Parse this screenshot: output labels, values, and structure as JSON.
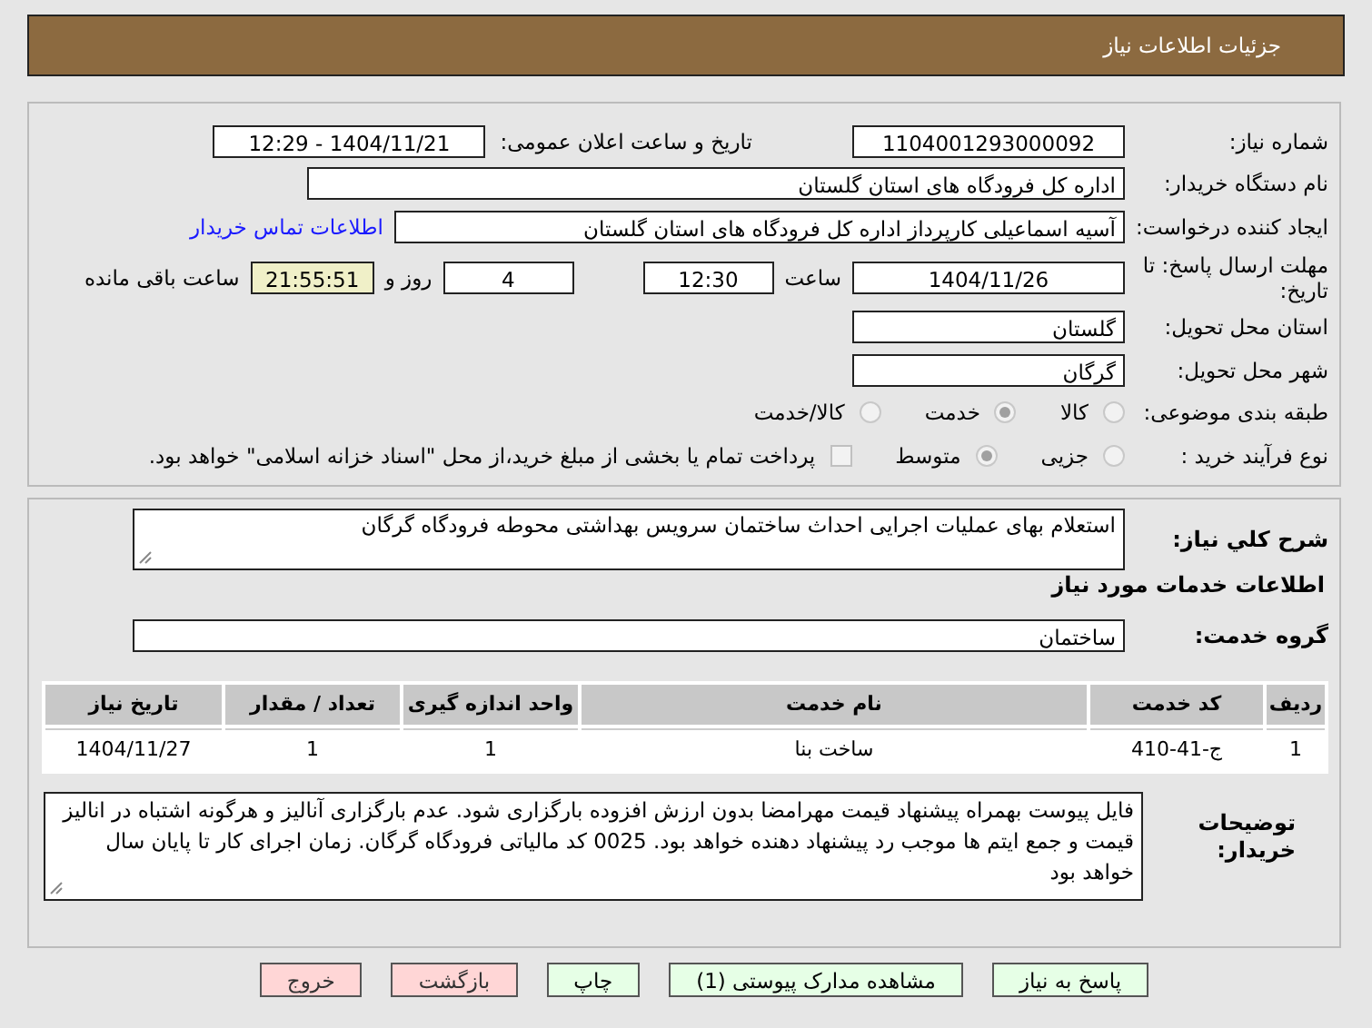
{
  "header": {
    "title": "جزئیات اطلاعات نیاز"
  },
  "need_number": {
    "label": "شماره نیاز:",
    "value": "1104001293000092"
  },
  "announce": {
    "label": "تاریخ و ساعت اعلان عمومی:",
    "value": "1404/11/21 - 12:29"
  },
  "buyer_org": {
    "label": "نام دستگاه خریدار:",
    "value": "اداره کل فرودگاه های استان گلستان"
  },
  "requester": {
    "label": "ایجاد کننده درخواست:",
    "value": "آسیه اسماعیلی کارپرداز اداره کل فرودگاه های استان گلستان",
    "link": "اطلاعات تماس خریدار"
  },
  "deadline": {
    "label": "مهلت ارسال پاسخ: تا تاریخ:",
    "date": "1404/11/26",
    "time_label": "ساعت",
    "time": "12:30",
    "days": "4",
    "days_label": "روز و",
    "remaining": "21:55:51",
    "remaining_label": "ساعت باقی مانده"
  },
  "province": {
    "label": "استان محل تحویل:",
    "value": "گلستان"
  },
  "city": {
    "label": "شهر محل تحویل:",
    "value": "گرگان"
  },
  "category": {
    "label": "طبقه بندی موضوعی:",
    "options": [
      {
        "label": "کالا",
        "selected": false
      },
      {
        "label": "خدمت",
        "selected": true
      },
      {
        "label": "کالا/خدمت",
        "selected": false
      }
    ]
  },
  "purchase_type": {
    "label": "نوع فرآیند خرید :",
    "options": [
      {
        "label": "جزیی",
        "selected": false
      },
      {
        "label": "متوسط",
        "selected": true
      }
    ],
    "payment_checkbox": {
      "checked": false,
      "label": "پرداخت تمام یا بخشی از مبلغ خرید،از محل \"اسناد خزانه اسلامی\" خواهد بود."
    }
  },
  "description": {
    "label": "شرح کلي نياز:",
    "value": "استعلام بهای عملیات اجرایی احداث ساختمان سرویس بهداشتی محوطه فرودگاه گرگان"
  },
  "services_heading": "اطلاعات خدمات مورد نیاز",
  "service_group": {
    "label": "گروه خدمت:",
    "value": "ساختمان"
  },
  "table": {
    "columns": [
      "ردیف",
      "کد خدمت",
      "نام خدمت",
      "واحد اندازه گیری",
      "تعداد / مقدار",
      "تاریخ نیاز"
    ],
    "rows": [
      [
        "1",
        "ج-41-410",
        "ساخت بنا",
        "1",
        "1",
        "1404/11/27"
      ]
    ]
  },
  "buyer_notes": {
    "label": "توضیحات خریدار:",
    "value": "فایل پیوست بهمراه پیشنهاد قیمت مهرامضا بدون ارزش افزوده بارگزاری شود. عدم بارگزاری آنالیز  و هرگونه اشتباه در انالیز قیمت و جمع ایتم ها  موجب رد پیشنهاد دهنده خواهد بود. 0025 کد مالیاتی فرودگاه گرگان. زمان اجرای کار تا پایان سال خواهد بود"
  },
  "buttons": [
    {
      "label": "پاسخ به نیاز",
      "kind": "normal"
    },
    {
      "label": "مشاهده مدارک پیوستی (1)",
      "kind": "normal"
    },
    {
      "label": "چاپ",
      "kind": "normal"
    },
    {
      "label": "بازگشت",
      "kind": "danger"
    },
    {
      "label": "خروج",
      "kind": "danger"
    }
  ]
}
